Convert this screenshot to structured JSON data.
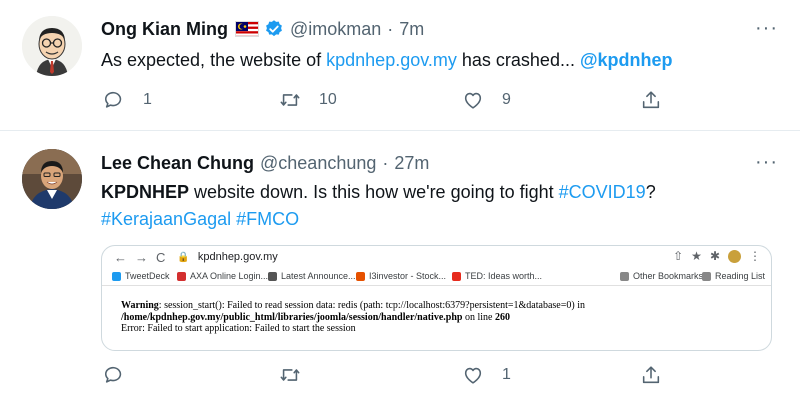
{
  "tweets": [
    {
      "author_name": "Ong Kian Ming",
      "handle": "@imokman",
      "separator": "·",
      "time": "7m",
      "more": "···",
      "text_before": "As expected, the website of ",
      "text_link": "kpdnhep.gov.my",
      "text_after": " has crashed... ",
      "text_mention": "@kpdnhep",
      "reply_count": "1",
      "retweet_count": "10",
      "like_count": "9"
    },
    {
      "author_name": "Lee Chean Chung",
      "handle": "@cheanchung",
      "separator": "·",
      "time": "27m",
      "more": "···",
      "text_bold": "KPDNHEP",
      "text_middle": " website down. Is this how we're going to fight ",
      "hashtag1": "#COVID19",
      "text_q": "?",
      "hashtag2": "#KerajaanGagal",
      "hashtag3": "#FMCO",
      "reply_count": "",
      "retweet_count": "",
      "like_count": "1",
      "embed": {
        "url": "kpdnhep.gov.my",
        "bookmarks": [
          {
            "label": "TweetDeck",
            "color": "#1d9bf0"
          },
          {
            "label": "AXA Online Login...",
            "color": "#d32f2f"
          },
          {
            "label": "Latest Announce...",
            "color": "#555555"
          },
          {
            "label": "I3investor - Stock...",
            "color": "#e65100"
          },
          {
            "label": "TED: Ideas worth...",
            "color": "#e62b1e"
          },
          {
            "label": "Other Bookmarks",
            "color": "#888888"
          },
          {
            "label": "Reading List",
            "color": "#888888"
          }
        ],
        "error_warning_label": "Warning",
        "error_line1": ": session_start(): Failed to read session data: redis (path: tcp://localhost:6379?persistent=1&database=0) in",
        "error_path": "/home/kpdnhep.gov.my/public_html/libraries/joomla/session/handler/native.php",
        "error_online": " on line ",
        "error_line_no": "260",
        "error_line3": "Error: Failed to start application: Failed to start the session"
      }
    }
  ],
  "colors": {
    "link": "#1d9bf0",
    "text": "#0f1419",
    "secondary": "#536471",
    "divider": "#e6ecf0"
  },
  "icons": [
    "reply-icon",
    "retweet-icon",
    "like-icon",
    "share-icon",
    "verified-icon",
    "malaysia-flag-icon",
    "more-icon"
  ]
}
